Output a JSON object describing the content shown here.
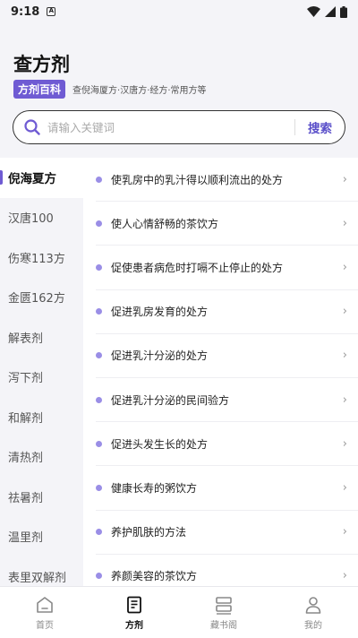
{
  "status_bar": {
    "time": "9:18",
    "notification_glyph": "A"
  },
  "header": {
    "title": "查方剂",
    "badge": "方剂百科",
    "description": "查倪海厦方·汉唐方·经方·常用方等"
  },
  "search": {
    "placeholder": "请输入关键词",
    "value": "",
    "button_label": "搜索"
  },
  "sidebar": {
    "items": [
      {
        "label": "倪海夏方",
        "active": true
      },
      {
        "label": "汉唐100",
        "active": false
      },
      {
        "label": "伤寒113方",
        "active": false
      },
      {
        "label": "金匮162方",
        "active": false
      },
      {
        "label": "解表剂",
        "active": false
      },
      {
        "label": "泻下剂",
        "active": false
      },
      {
        "label": "和解剂",
        "active": false
      },
      {
        "label": "清热剂",
        "active": false
      },
      {
        "label": "祛暑剂",
        "active": false
      },
      {
        "label": "温里剂",
        "active": false
      },
      {
        "label": "表里双解剂",
        "active": false
      }
    ]
  },
  "list": {
    "items": [
      "使乳房中的乳汁得以顺利流出的处方",
      "使人心情舒畅的茶饮方",
      "促使患者病危时打嗝不止停止的处方",
      "促进乳房发育的处方",
      "促进乳汁分泌的处方",
      "促进乳汁分泌的民间验方",
      "促进头发生长的处方",
      "健康长寿的粥饮方",
      "养护肌肤的方法",
      "养颜美容的茶饮方"
    ]
  },
  "bottom_nav": {
    "items": [
      {
        "label": "首页",
        "icon": "home-icon",
        "active": false
      },
      {
        "label": "方剂",
        "icon": "document-icon",
        "active": true
      },
      {
        "label": "藏书阁",
        "icon": "bookshelf-icon",
        "active": false
      },
      {
        "label": "我的",
        "icon": "user-icon",
        "active": false
      }
    ]
  },
  "colors": {
    "accent": "#6f5bd3",
    "dot": "#9a8ee6",
    "search_button": "#5a4fc9"
  }
}
